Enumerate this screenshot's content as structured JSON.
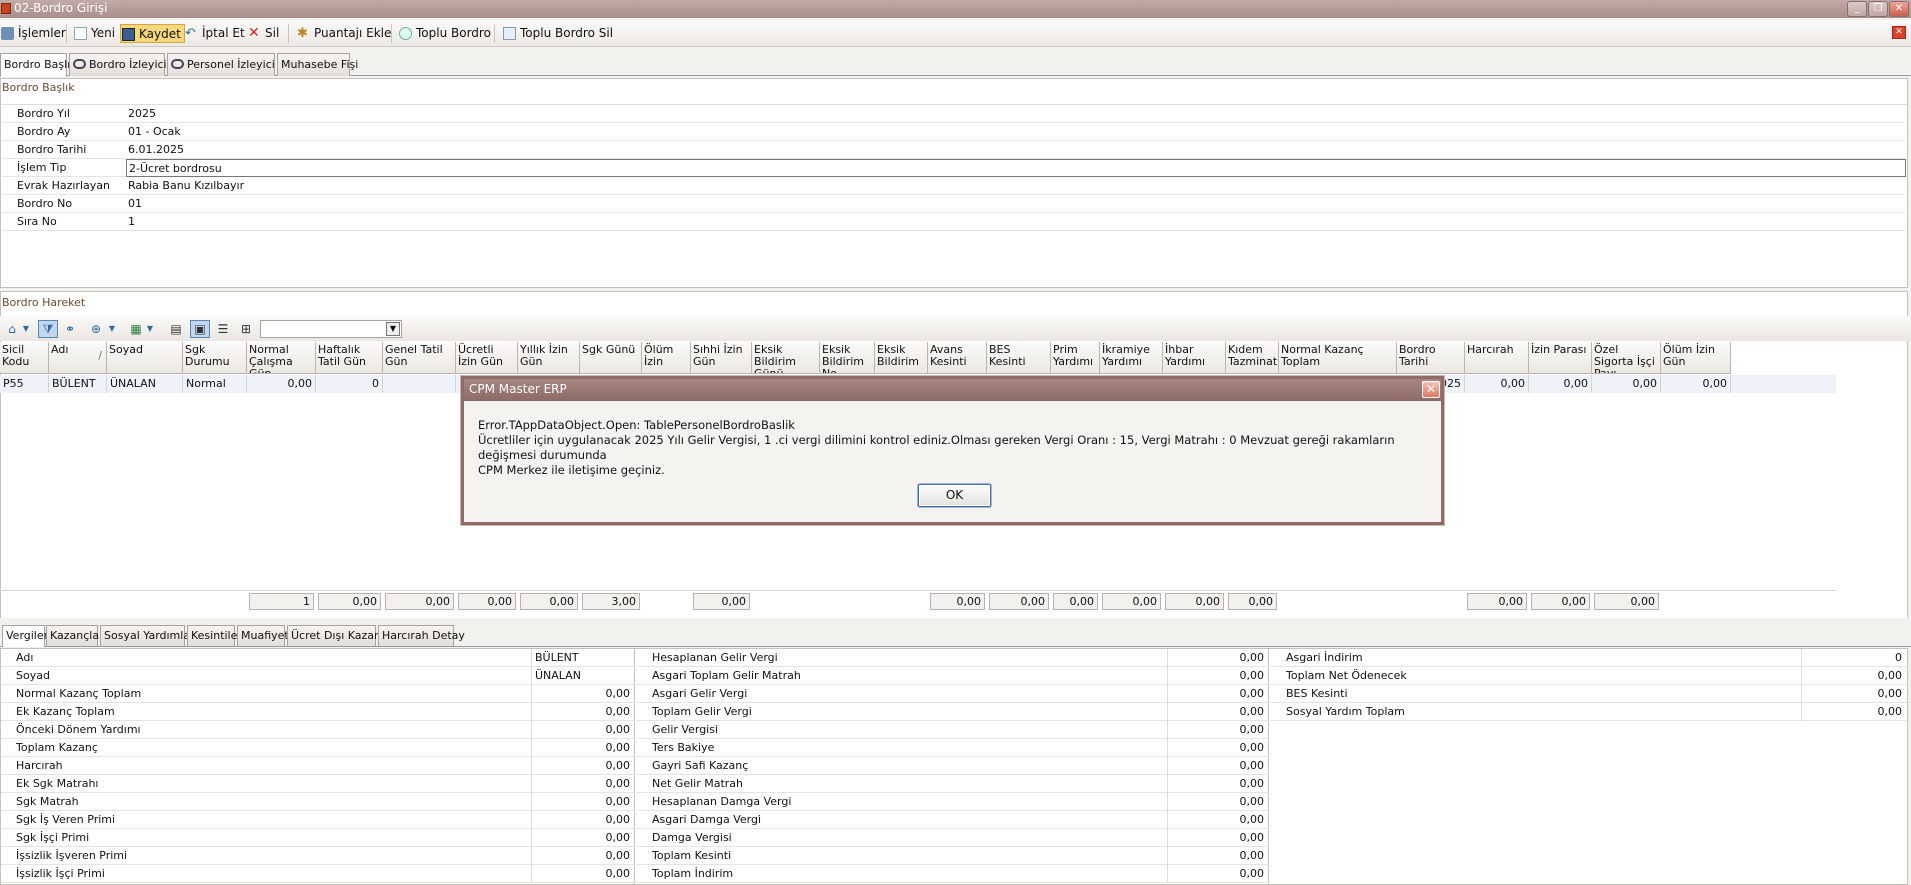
{
  "window": {
    "title": "02-Bordro Girişi"
  },
  "toolbar": {
    "islemler": "İşlemler",
    "yeni": "Yeni",
    "kaydet": "Kaydet",
    "iptal": "İptal Et",
    "sil": "Sil",
    "puantaj": "Puantajı Ekle",
    "toplu_bordro": "Toplu Bordro",
    "toplu_bordro_sil": "Toplu Bordro Sil"
  },
  "main_tabs": [
    "Bordro Başlık",
    "Bordro İzleyici",
    "Personel İzleyici",
    "Muhasebe Fişi"
  ],
  "header_section": {
    "title": "Bordro Başlık",
    "fields": [
      {
        "label": "Bordro Yıl",
        "value": "2025"
      },
      {
        "label": "Bordro Ay",
        "value": "01 - Ocak"
      },
      {
        "label": "Bordro Tarihi",
        "value": "6.01.2025"
      },
      {
        "label": "İşlem Tip",
        "value": "2-Ücret bordrosu"
      },
      {
        "label": "Evrak Hazırlayan",
        "value": "Rabia Banu Kızılbayır"
      },
      {
        "label": "Bordro No",
        "value": "01"
      },
      {
        "label": "Sıra No",
        "value": "1"
      }
    ]
  },
  "hareket": {
    "title": "Bordro Hareket",
    "search_value": "",
    "columns": [
      "Sicil Kodu",
      "Adı",
      "Soyad",
      "Sgk Durumu",
      "Normal Çalışma Gün",
      "Haftalık Tatil Gün",
      "Genel Tatil Gün",
      "Ücretli İzin Gün",
      "Yıllık İzin Gün",
      "Sgk Günü",
      "Ölüm İzin",
      "Sıhhi İzin Gün",
      "Eksik Bildirim Günü",
      "Eksik Bildirim No",
      "Eksik Bildirim",
      "Avans Kesinti",
      "BES Kesinti",
      "Prim Yardımı",
      "İkramiye Yardımı",
      "İhbar Yardımı",
      "Kıdem Tazminat",
      "Normal Kazanç Toplam",
      "Bordro Tarihi",
      "Harcırah",
      "İzin Parası",
      "Özel Sigorta İşçi Payı",
      "Ölüm İzin Gün"
    ],
    "row": [
      "P55",
      "BÜLENT",
      "ÜNALAN",
      "Normal",
      "0,00",
      "0",
      "",
      "",
      "",
      "",
      "",
      "",
      "",
      "",
      "",
      "",
      "",
      "",
      "",
      "",
      "",
      "0,00",
      "5.01.2025",
      "0,00",
      "0,00",
      "0,00",
      "0,00"
    ],
    "footer": [
      "",
      "",
      "",
      "",
      "1",
      "0,00",
      "0,00",
      "0,00",
      "0,00",
      "3,00",
      "",
      "0,00",
      "",
      "",
      "",
      "0,00",
      "0,00",
      "0,00",
      "0,00",
      "0,00",
      "0,00",
      "",
      "",
      "0,00",
      "0,00",
      "0,00",
      ""
    ]
  },
  "bottom_tabs": [
    "Vergiler",
    "Kazançlar",
    "Sosyal Yardımlar",
    "Kesintiler",
    "Muafiyet",
    "Ücret Dışı Kazanç",
    "Harcırah Detay"
  ],
  "summary": {
    "col1": [
      {
        "label": "Adı",
        "value": "BÜLENT"
      },
      {
        "label": "Soyad",
        "value": "ÜNALAN"
      },
      {
        "label": "Normal Kazanç Toplam",
        "value": "0,00"
      },
      {
        "label": "Ek Kazanç Toplam",
        "value": "0,00"
      },
      {
        "label": "Önceki Dönem Yardımı",
        "value": "0,00"
      },
      {
        "label": "Toplam Kazanç",
        "value": "0,00"
      },
      {
        "label": "Harcırah",
        "value": "0,00"
      },
      {
        "label": "Ek Sgk Matrahı",
        "value": "0,00"
      },
      {
        "label": "Sgk Matrah",
        "value": "0,00"
      },
      {
        "label": "Sgk İş Veren Primi",
        "value": "0,00"
      },
      {
        "label": "Sgk İşçi Primi",
        "value": "0,00"
      },
      {
        "label": "İşsizlik İşveren Primi",
        "value": "0,00"
      },
      {
        "label": "İşsizlik İşçi Primi",
        "value": "0,00"
      }
    ],
    "col2": [
      {
        "label": "Hesaplanan Gelir Vergi",
        "value": "0,00"
      },
      {
        "label": "Asgari Toplam Gelir Matrah",
        "value": "0,00"
      },
      {
        "label": "Asgari Gelir Vergi",
        "value": "0,00"
      },
      {
        "label": "Toplam Gelir Vergi",
        "value": "0,00"
      },
      {
        "label": "Gelir Vergisi",
        "value": "0,00"
      },
      {
        "label": "Ters Bakiye",
        "value": "0,00"
      },
      {
        "label": "Gayri Safi Kazanç",
        "value": "0,00"
      },
      {
        "label": "Net Gelir Matrah",
        "value": "0,00"
      },
      {
        "label": "Hesaplanan Damga Vergi",
        "value": "0,00"
      },
      {
        "label": "Asgari Damga Vergi",
        "value": "0,00"
      },
      {
        "label": "Damga Vergisi",
        "value": "0,00"
      },
      {
        "label": "Toplam Kesinti",
        "value": "0,00"
      },
      {
        "label": "Toplam İndirim",
        "value": "0,00"
      }
    ],
    "col3": [
      {
        "label": "Asgari İndirim",
        "value": "0"
      },
      {
        "label": "Toplam Net Ödenecek",
        "value": "0,00"
      },
      {
        "label": "BES Kesinti",
        "value": "0,00"
      },
      {
        "label": "Sosyal Yardım Toplam",
        "value": "0,00"
      }
    ]
  },
  "dialog": {
    "title": "CPM Master ERP",
    "line1": "Error.TAppDataObject.Open: TablePersonelBordroBaslik",
    "line2": "Ücretliler için uygulanacak 2025 Yılı Gelir Vergisi, 1 .ci vergi dilimini kontrol ediniz.Olması gereken Vergi Oranı : 15, Vergi Matrahı : 0  Mevzuat gereği rakamların değişmesi durumunda",
    "line3": "CPM Merkez ile iletişime geçiniz.",
    "ok": "OK"
  }
}
